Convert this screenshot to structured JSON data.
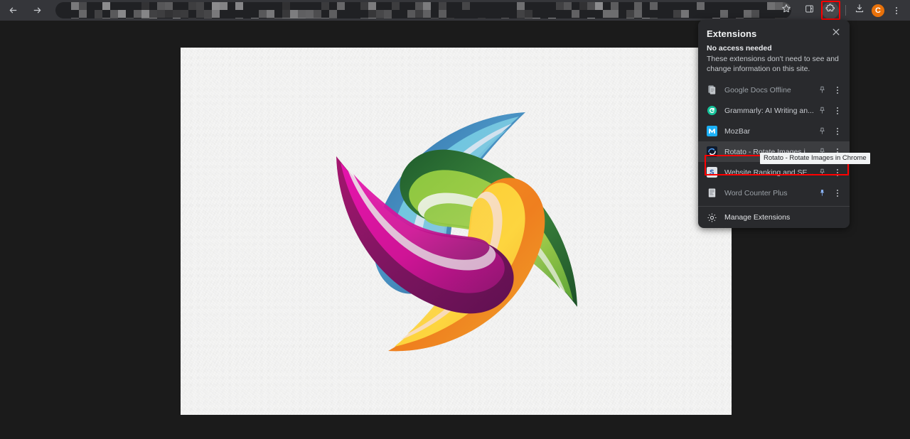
{
  "browser": {
    "toolbar": {
      "back_icon": "arrow-left-icon",
      "forward_icon": "arrow-right-icon",
      "reload_icon": "reload-icon",
      "bookmark_icon": "star-icon",
      "sidepanel_icon": "side-panel-icon",
      "extensions_icon": "puzzle-piece-icon",
      "downloads_icon": "download-icon",
      "menu_icon": "three-dot-menu-icon",
      "profile_initial": "C",
      "profile_color": "#e8710a",
      "highlight_color": "#ff0000"
    },
    "omnibox": {
      "value": "",
      "placeholder": "",
      "redacted": true
    }
  },
  "page": {
    "background_color": "#1b1b1b",
    "image": {
      "name": "colorful-pinwheel-logo",
      "background_color": "#f1f1f0",
      "petals": [
        {
          "name": "blue-petal",
          "colors": [
            "#2e6da4",
            "#55c4de",
            "#c9dce9",
            "#3f7fb5"
          ]
        },
        {
          "name": "green-petal",
          "colors": [
            "#1f5c2c",
            "#8cc63f",
            "#d9e8c8",
            "#3f8c3f"
          ]
        },
        {
          "name": "orange-petal",
          "colors": [
            "#f0881f",
            "#fdc830",
            "#fae0c0",
            "#f7a31c"
          ]
        },
        {
          "name": "magenta-petal",
          "colors": [
            "#a51d6e",
            "#e317b0",
            "#e8c8dd",
            "#7b1560"
          ]
        }
      ]
    }
  },
  "extensions_popup": {
    "title": "Extensions",
    "close_label": "×",
    "access_section": {
      "heading": "No access needed",
      "description": "These extensions don't need to see and change information on this site."
    },
    "items": [
      {
        "name": "Google Docs Offline",
        "icon": "google-docs-offline-icon",
        "icon_color": "#8a8d91",
        "dim": true,
        "pinned": false,
        "highlighted": false
      },
      {
        "name": "Grammarly: AI Writing an...",
        "icon": "grammarly-icon",
        "icon_color": "#15c39a",
        "dim": false,
        "pinned": false,
        "highlighted": false
      },
      {
        "name": "MozBar",
        "icon": "mozbar-icon",
        "icon_color": "#1cb0f6",
        "dim": false,
        "pinned": false,
        "highlighted": false
      },
      {
        "name": "Rotato - Rotate Images i...",
        "icon": "rotato-icon",
        "icon_color": "#1a1a2e",
        "dim": false,
        "pinned": false,
        "highlighted": true
      },
      {
        "name": "Website Ranking and SE...",
        "icon": "website-ranking-seo-icon",
        "icon_color": "#2a5db0",
        "dim": false,
        "pinned": false,
        "highlighted": false
      },
      {
        "name": "Word Counter Plus",
        "icon": "word-counter-plus-icon",
        "icon_color": "#9aa0a6",
        "dim": true,
        "pinned": true,
        "highlighted": false
      }
    ],
    "tooltip": {
      "text": "Rotato - Rotate Images in Chrome",
      "target": "Rotato - Rotate Images i..."
    },
    "manage": {
      "label": "Manage Extensions",
      "icon": "gear-icon"
    },
    "pin_icon": "pin-icon",
    "more_icon": "three-dot-menu-icon"
  }
}
